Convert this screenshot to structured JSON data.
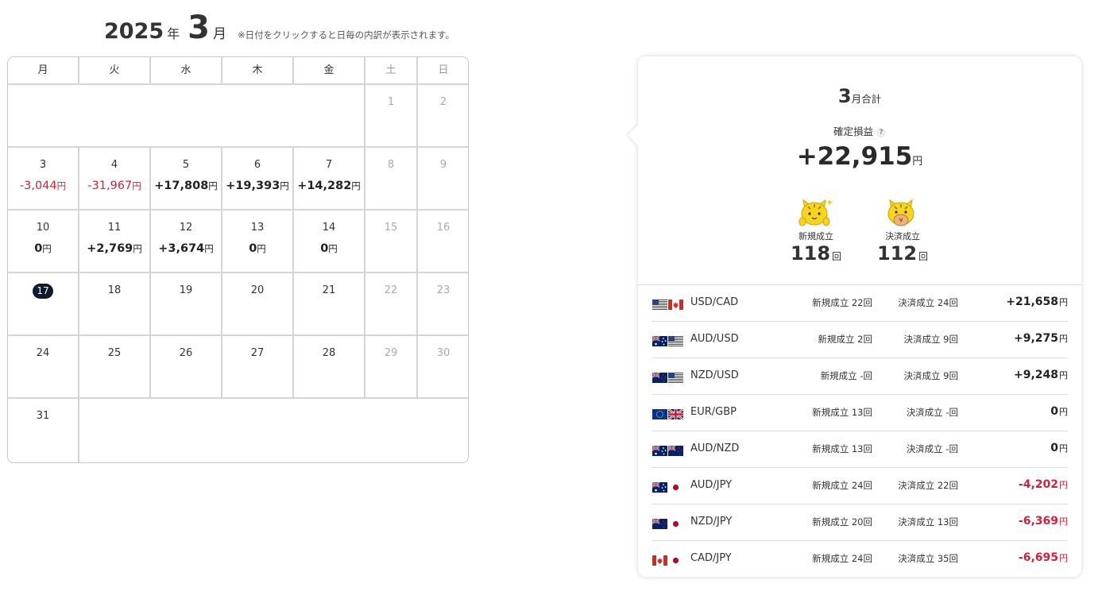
{
  "calendar": {
    "year": "2025",
    "year_unit": "年",
    "month": "3",
    "month_unit": "月",
    "note": "※日付をクリックすると日毎の内訳が表示されます。",
    "weekdays": [
      "月",
      "火",
      "水",
      "木",
      "金",
      "土",
      "日"
    ],
    "days": {
      "d1": "1",
      "d2": "2",
      "d3": "3",
      "d4": "4",
      "d5": "5",
      "d6": "6",
      "d7": "7",
      "d8": "8",
      "d9": "9",
      "d10": "10",
      "d11": "11",
      "d12": "12",
      "d13": "13",
      "d14": "14",
      "d15": "15",
      "d16": "16",
      "d17": "17",
      "d18": "18",
      "d19": "19",
      "d20": "20",
      "d21": "21",
      "d22": "22",
      "d23": "23",
      "d24": "24",
      "d25": "25",
      "d26": "26",
      "d27": "27",
      "d28": "28",
      "d29": "29",
      "d30": "30",
      "d31": "31"
    },
    "pl": {
      "d3": "-3,044",
      "d4": "-31,967",
      "d5": "+17,808",
      "d6": "+19,393",
      "d7": "+14,282",
      "d10": "0",
      "d11": "+2,769",
      "d12": "+3,674",
      "d13": "0",
      "d14": "0"
    },
    "yen": "円",
    "today": "17"
  },
  "summary": {
    "month": "3",
    "month_total_label": "月合計",
    "kakutei_label": "確定損益",
    "help_icon": "?",
    "total": "+22,915",
    "yen": "円",
    "new_label": "新規成立",
    "new_count": "118",
    "settle_label": "決済成立",
    "settle_count": "112",
    "count_unit": "回"
  },
  "pairs": [
    {
      "name": "USD/CAD",
      "flags": [
        "us",
        "ca"
      ],
      "new": "新規成立 22回",
      "settle": "決済成立 24回",
      "pl": "+21,658",
      "yen": "円",
      "negative": false
    },
    {
      "name": "AUD/USD",
      "flags": [
        "au",
        "us"
      ],
      "new": "新規成立 2回",
      "settle": "決済成立 9回",
      "pl": "+9,275",
      "yen": "円",
      "negative": false
    },
    {
      "name": "NZD/USD",
      "flags": [
        "nz",
        "us"
      ],
      "new": "新規成立 -回",
      "settle": "決済成立 9回",
      "pl": "+9,248",
      "yen": "円",
      "negative": false
    },
    {
      "name": "EUR/GBP",
      "flags": [
        "eu",
        "gb"
      ],
      "new": "新規成立 13回",
      "settle": "決済成立 -回",
      "pl": "0",
      "yen": "円",
      "negative": false
    },
    {
      "name": "AUD/NZD",
      "flags": [
        "au",
        "nz"
      ],
      "new": "新規成立 13回",
      "settle": "決済成立 -回",
      "pl": "0",
      "yen": "円",
      "negative": false
    },
    {
      "name": "AUD/JPY",
      "flags": [
        "au",
        "jp"
      ],
      "new": "新規成立 24回",
      "settle": "決済成立 22回",
      "pl": "-4,202",
      "yen": "円",
      "negative": true
    },
    {
      "name": "NZD/JPY",
      "flags": [
        "nz",
        "jp"
      ],
      "new": "新規成立 20回",
      "settle": "決済成立 13回",
      "pl": "-6,369",
      "yen": "円",
      "negative": true
    },
    {
      "name": "CAD/JPY",
      "flags": [
        "ca",
        "jp"
      ],
      "new": "新規成立 24回",
      "settle": "決済成立 35回",
      "pl": "-6,695",
      "yen": "円",
      "negative": true
    }
  ],
  "colors": {
    "negative": "#d0213d",
    "today_bg": "#0f1b2d",
    "mascot_yellow": "#f7d51d"
  }
}
